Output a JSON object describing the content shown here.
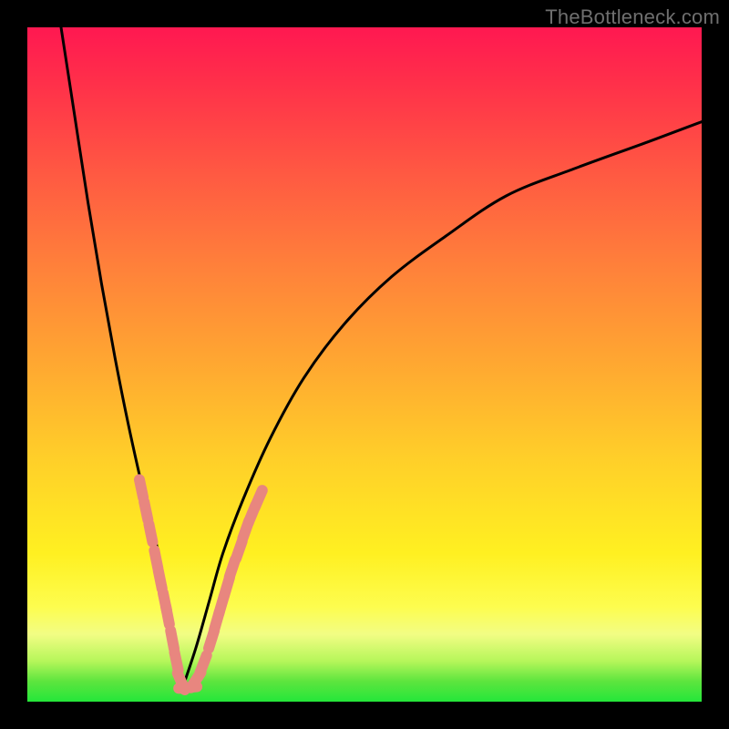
{
  "watermark": "TheBottleneck.com",
  "chart_data": {
    "type": "line",
    "title": "",
    "xlabel": "",
    "ylabel": "",
    "xlim": [
      0,
      100
    ],
    "ylim": [
      0,
      100
    ],
    "note": "Axes unlabeled; x and y are percent of plot width/height. Two curves forming a V with minimum near x≈23. Salmon dashes mark sampled points near the bottom of each curve.",
    "series": [
      {
        "name": "left-curve",
        "x": [
          5,
          7,
          9,
          11,
          13,
          15,
          17,
          18,
          19,
          20,
          21,
          22,
          23
        ],
        "y": [
          100,
          87,
          74,
          62,
          51,
          41,
          32,
          28,
          24,
          19,
          13,
          7,
          2
        ]
      },
      {
        "name": "right-curve",
        "x": [
          23,
          25,
          27,
          29,
          32,
          36,
          41,
          47,
          54,
          62,
          71,
          81,
          92,
          100
        ],
        "y": [
          2,
          8,
          15,
          22,
          30,
          39,
          48,
          56,
          63,
          69,
          75,
          79,
          83,
          86
        ]
      }
    ],
    "markers": {
      "name": "salmon-dashes",
      "color": "#e8867f",
      "points": [
        {
          "x": 16.9,
          "y": 31.6
        },
        {
          "x": 17.6,
          "y": 28.3
        },
        {
          "x": 18.3,
          "y": 25.0
        },
        {
          "x": 19.1,
          "y": 21.1
        },
        {
          "x": 19.7,
          "y": 18.1
        },
        {
          "x": 20.4,
          "y": 14.8
        },
        {
          "x": 20.8,
          "y": 12.8
        },
        {
          "x": 21.5,
          "y": 9.2
        },
        {
          "x": 22.1,
          "y": 6.0
        },
        {
          "x": 22.8,
          "y": 3.0
        },
        {
          "x": 23.8,
          "y": 2.1
        },
        {
          "x": 25.0,
          "y": 3.2
        },
        {
          "x": 26.1,
          "y": 5.6
        },
        {
          "x": 27.3,
          "y": 9.2
        },
        {
          "x": 28.1,
          "y": 12.0
        },
        {
          "x": 28.8,
          "y": 14.4
        },
        {
          "x": 29.6,
          "y": 17.1
        },
        {
          "x": 30.4,
          "y": 19.8
        },
        {
          "x": 31.4,
          "y": 22.5
        },
        {
          "x": 32.4,
          "y": 25.5
        },
        {
          "x": 33.3,
          "y": 27.8
        },
        {
          "x": 34.3,
          "y": 30.1
        }
      ]
    }
  }
}
